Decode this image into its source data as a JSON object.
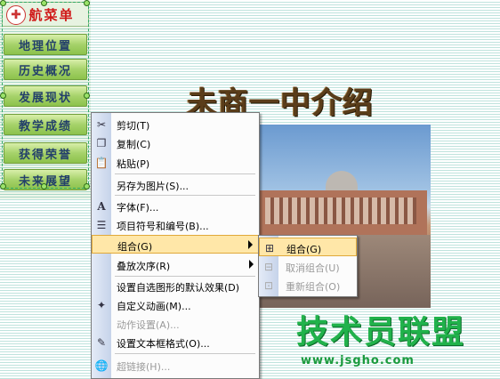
{
  "nav": {
    "title": "航菜单",
    "items": [
      "地理位置",
      "历史概况",
      "发展现状",
      "教学成绩",
      "获得荣誉",
      "未来展望"
    ]
  },
  "slide": {
    "heading": "未商一中介绍"
  },
  "context_menu": {
    "items": [
      {
        "label": "剪切(T)",
        "icon": "scissors-icon"
      },
      {
        "label": "复制(C)",
        "icon": "copy-icon"
      },
      {
        "label": "粘贴(P)",
        "icon": "paste-icon"
      },
      {
        "label": "另存为图片(S)...",
        "icon": ""
      },
      {
        "label": "字体(F)...",
        "icon": "font-icon"
      },
      {
        "label": "项目符号和编号(B)...",
        "icon": "bullets-icon"
      },
      {
        "label": "组合(G)",
        "icon": "",
        "submenu": true
      },
      {
        "label": "叠放次序(R)",
        "icon": "",
        "submenu": true
      },
      {
        "label": "设置自选图形的默认效果(D)",
        "icon": ""
      },
      {
        "label": "自定义动画(M)...",
        "icon": "animation-icon"
      },
      {
        "label": "动作设置(A)...",
        "icon": ""
      },
      {
        "label": "设置文本框格式(O)...",
        "icon": "format-textbox-icon"
      },
      {
        "label": "超链接(H)...",
        "icon": "hyperlink-icon"
      }
    ]
  },
  "submenu": {
    "items": [
      {
        "label": "组合(G)",
        "icon": "group-icon"
      },
      {
        "label": "取消组合(U)",
        "icon": "ungroup-icon"
      },
      {
        "label": "重新组合(O)",
        "icon": "regroup-icon"
      }
    ]
  },
  "watermark": {
    "name": "技术员联盟",
    "url": "www.jsgho.com"
  }
}
